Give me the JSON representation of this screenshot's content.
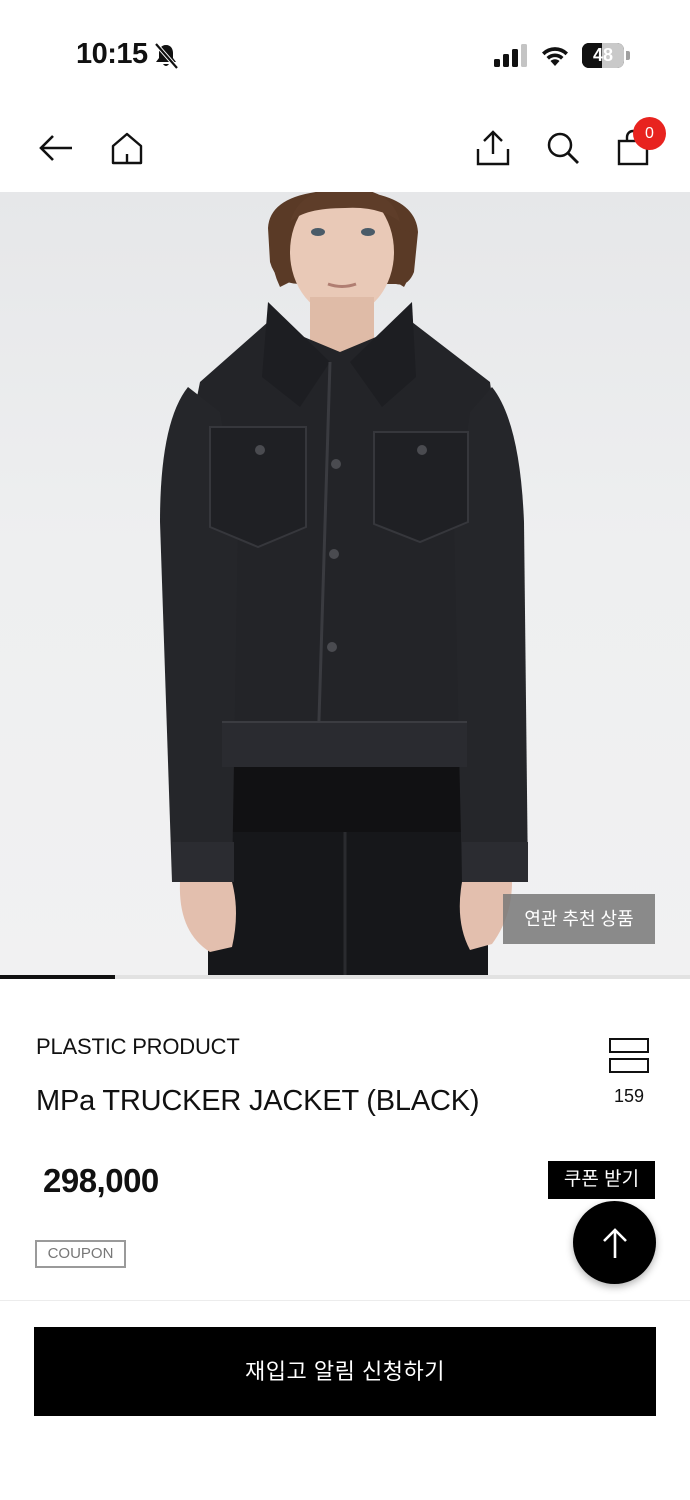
{
  "status_bar": {
    "time": "10:15",
    "battery_level": "48",
    "battery_percent": 48,
    "icons": [
      "bell-off-icon",
      "signal-icon",
      "wifi-icon",
      "battery-icon"
    ]
  },
  "nav": {
    "icons": [
      "arrow-left-icon",
      "home-icon",
      "share-icon",
      "search-icon",
      "shopping-bag-icon"
    ],
    "cart_count": "0",
    "cart_badge_color": "#e8231f"
  },
  "gallery": {
    "related_label": "연관 추천 상품",
    "progress_fraction": 0.166
  },
  "product": {
    "brand": "PLASTIC PRODUCT",
    "name": "MPa TRUCKER JACKET (BLACK)",
    "wish_count": "159",
    "price": "298,000",
    "coupon_button": "쿠폰 받기",
    "coupon_tag": "COUPON"
  },
  "actions": {
    "restock_button": "재입고 알림 신청하기"
  }
}
